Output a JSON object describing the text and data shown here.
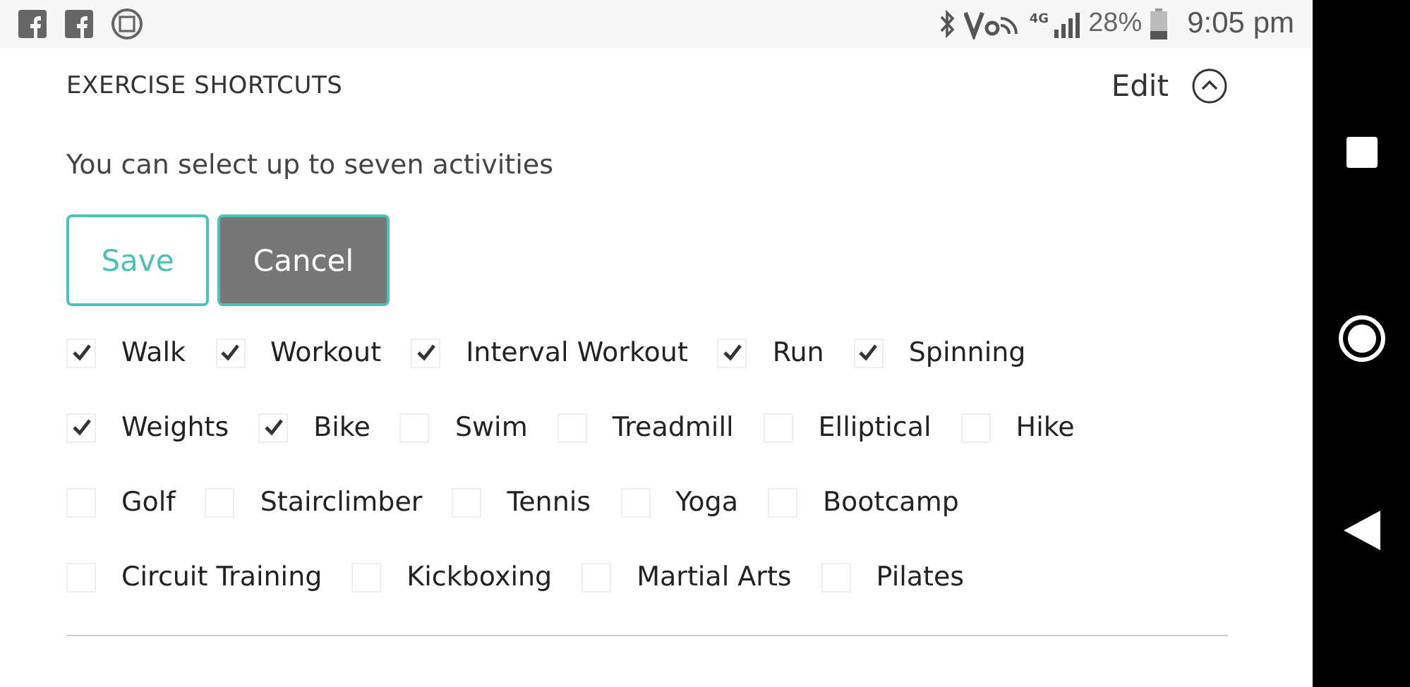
{
  "status_bar": {
    "network": "4G",
    "battery": "28%",
    "time": "9:05 pm"
  },
  "section": {
    "title": "EXERCISE SHORTCUTS",
    "edit": "Edit",
    "expanded": true
  },
  "hint": "You can select up to seven activities",
  "buttons": [
    {
      "label": "Save",
      "kind": "outline"
    },
    {
      "label": "Cancel",
      "kind": "filled"
    }
  ],
  "activity_rows": [
    [
      {
        "label": "Walk",
        "checked": true
      },
      {
        "label": "Workout",
        "checked": true
      },
      {
        "label": "Interval Workout",
        "checked": true
      },
      {
        "label": "Run",
        "checked": true
      },
      {
        "label": "Spinning",
        "checked": true
      }
    ],
    [
      {
        "label": "Weights",
        "checked": true
      },
      {
        "label": "Bike",
        "checked": true
      },
      {
        "label": "Swim",
        "checked": false
      },
      {
        "label": "Treadmill",
        "checked": false
      },
      {
        "label": "Elliptical",
        "checked": false
      },
      {
        "label": "Hike",
        "checked": false
      }
    ],
    [
      {
        "label": "Golf",
        "checked": false
      },
      {
        "label": "Stairclimber",
        "checked": false
      },
      {
        "label": "Tennis",
        "checked": false
      },
      {
        "label": "Yoga",
        "checked": false
      },
      {
        "label": "Bootcamp",
        "checked": false
      }
    ],
    [
      {
        "label": "Circuit Training",
        "checked": false
      },
      {
        "label": "Kickboxing",
        "checked": false
      },
      {
        "label": "Martial Arts",
        "checked": false
      },
      {
        "label": "Pilates",
        "checked": false
      }
    ]
  ]
}
